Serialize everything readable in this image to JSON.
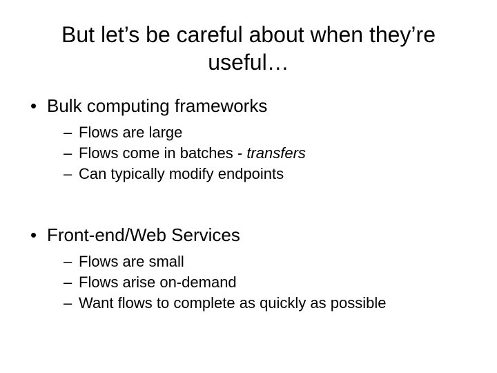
{
  "title": "But let’s be careful about when they’re useful…",
  "sections": [
    {
      "heading": "Bulk computing frameworks",
      "items": [
        {
          "prefix": "Flows are large",
          "em": ""
        },
        {
          "prefix": "Flows come in batches - ",
          "em": "transfers"
        },
        {
          "prefix": "Can typically modify endpoints",
          "em": ""
        }
      ]
    },
    {
      "heading": "Front-end/Web Services",
      "items": [
        {
          "prefix": "Flows are small",
          "em": ""
        },
        {
          "prefix": "Flows arise on-demand",
          "em": ""
        },
        {
          "prefix": "Want flows to complete as quickly as possible",
          "em": ""
        }
      ]
    }
  ]
}
